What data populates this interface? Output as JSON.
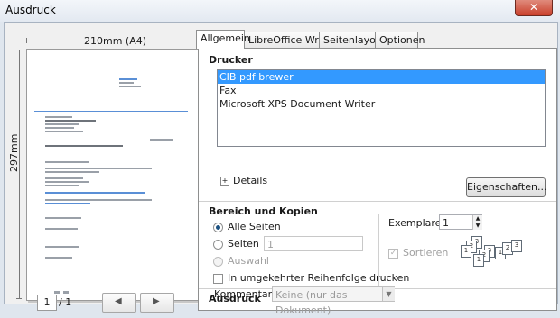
{
  "window": {
    "title": "Ausdruck",
    "close_glyph": "✕"
  },
  "preview": {
    "width_label": "210mm (A4)",
    "height_label": "297mm",
    "current_page": "1",
    "page_count": "/ 1",
    "prev_glyph": "◀",
    "next_glyph": "▶"
  },
  "tabs": [
    {
      "label": "Allgemein"
    },
    {
      "label": "LibreOffice Writer"
    },
    {
      "label": "Seitenlayout"
    },
    {
      "label": "Optionen"
    }
  ],
  "printer": {
    "heading": "Drucker",
    "items": [
      "CIB pdf brewer",
      "Fax",
      "Microsoft XPS Document Writer"
    ],
    "selected_index": 0,
    "details_label": "Details",
    "expander_glyph": "+",
    "properties_button": "Eigenschaften..."
  },
  "range": {
    "heading": "Bereich und Kopien",
    "all_pages": "Alle Seiten",
    "pages": "Seiten",
    "pages_value": "1",
    "selection": "Auswahl",
    "reverse": "In umgekehrter Reihenfolge drucken"
  },
  "copies": {
    "label": "Exemplare",
    "value": "1",
    "collate": "Sortieren",
    "spin_up": "▲",
    "spin_down": "▼"
  },
  "output": {
    "heading": "Ausdruck",
    "comment_label": "Kommentar",
    "comment_value": "Keine (nur das Dokument)",
    "dropdown_glyph": "▼"
  }
}
